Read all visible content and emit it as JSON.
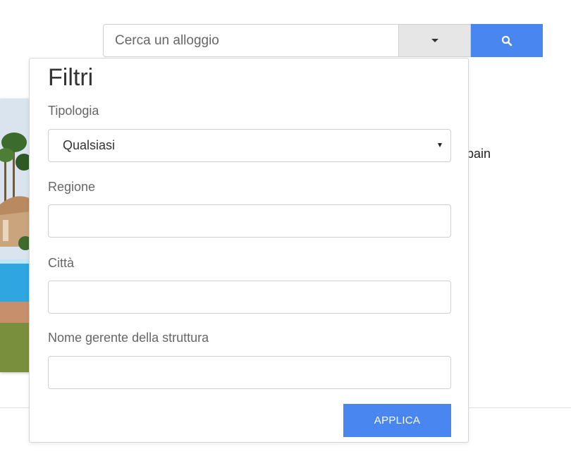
{
  "search": {
    "placeholder": "Cerca un alloggio"
  },
  "listing": {
    "location_text": ", Spain"
  },
  "filters": {
    "title": "Filtri",
    "type_label": "Tipologia",
    "type_selected": "Qualsiasi",
    "region_label": "Regione",
    "region_value": "",
    "city_label": "Città",
    "city_value": "",
    "manager_label": "Nome gerente della struttura",
    "manager_value": "",
    "apply_label": "APPLICA"
  },
  "colors": {
    "accent": "#4a86f0",
    "toggle_bg": "#e6e6e6"
  }
}
